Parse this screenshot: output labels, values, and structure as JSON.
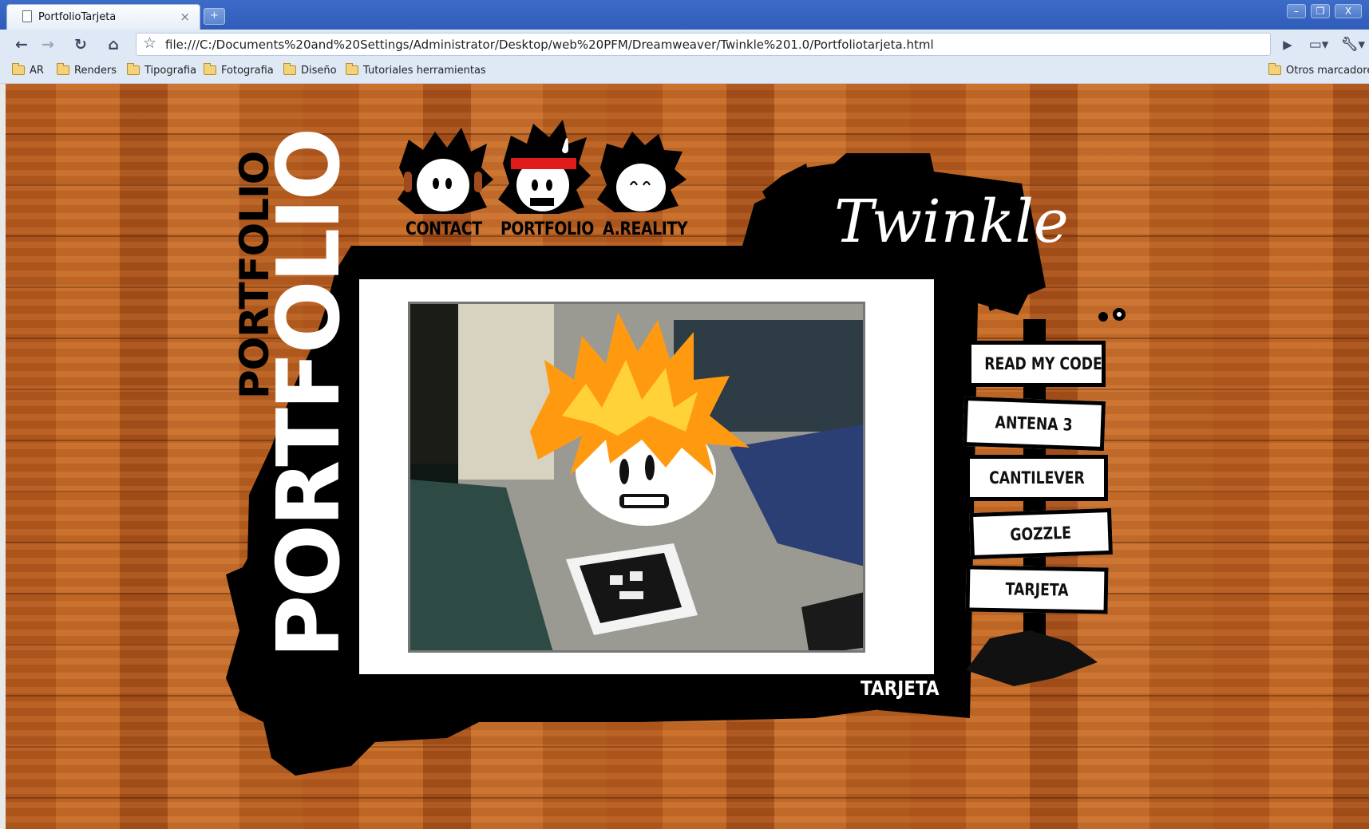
{
  "browser": {
    "tab_title": "PortfolioTarjeta",
    "tab_close": "×",
    "new_tab": "+",
    "address": "file:///C:/Documents%20and%20Settings/Administrator/Desktop/web%20PFM/Dreamweaver/Twinkle%201.0/Portfoliotarjeta.html",
    "bookmarks": [
      "AR",
      "Renders",
      "Tipografia",
      "Fotografia",
      "Diseño",
      "Tutoriales herramientas"
    ],
    "other_bookmarks": "Otros marcadores",
    "controls": {
      "minimize": "–",
      "restore": "❐",
      "close": "X"
    }
  },
  "page": {
    "nav": [
      "CONTACT",
      "PORTFOLIO",
      "A.REALITY"
    ],
    "brand": "Twinkle",
    "side_title_small": "PORTFOLIO",
    "side_title_big": "PORTFOLIO",
    "section_label": "TARJETA",
    "signs": [
      "READ MY CODE",
      "ANTENA 3",
      "CANTILEVER",
      "GOZZLE",
      "TARJETA"
    ]
  }
}
